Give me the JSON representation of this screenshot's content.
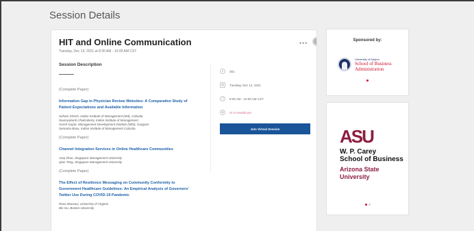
{
  "page": {
    "title": "Session Details"
  },
  "session": {
    "title": "HIT and Online Communication",
    "datetime": "Tuesday, Dec 14, 2021 at 8:30 AM - 10:00 AM CST",
    "more_icon": "more-horizontal-icon",
    "description_heading": "Session Description"
  },
  "papers": [
    {
      "type": "(Complete Paper)",
      "title_line1": "Information Gap in Physician Review Websites: A Comparative Study of",
      "title_line2": "Patient Expectations and Available Information",
      "authors": [
        "Soham Ghosh, Indian Institute of Management (IIM), Calcutta",
        "Soumyakanti Chakraborty, Indian Institute of Management",
        "Harsh Gupta, Management Development Institute (MDI), Gurgaon",
        "Samanta Basu, Indian Institute of Management Calcutta"
      ]
    },
    {
      "type": "(Complete Paper)",
      "title_line1": "Channel Integration Services in Online Healthcare Communities",
      "title_line2": "",
      "authors": [
        "Anqi Zhao, Singapore Management University",
        "Qian Tang, Singapore Management University"
      ]
    },
    {
      "type": "(Complete Paper)",
      "title_line1": "The Effect of Resilience Messaging on Community Conformity to",
      "title_line2": "Government Healthcare Guidelines: An Empirical Analysis of Governors'",
      "title_line3": "Twitter Use During COVID-19 Pandemic",
      "authors": [
        "Reza Mousavi, University of Virginia",
        "Bin Gu, Boston University"
      ]
    }
  ],
  "info": {
    "room": "301",
    "date": "Tuesday, Dec 14, 2021",
    "time": "8:30 AM - 10:00 AM CST",
    "track": "IS in Healthcare",
    "join_label": "Join Virtual Session"
  },
  "sponsor": {
    "heading": "Sponsored by:",
    "dayton_small": "University of Dayton",
    "dayton_line1": "School of Business",
    "dayton_line2": "Administration"
  },
  "asu": {
    "mark": "ASU",
    "line1": "W. P. Carey",
    "line2": "School of Business",
    "line3": "Arizona State",
    "line4": "University"
  },
  "colors": {
    "accent": "#1a5499",
    "link": "#1a5fa8",
    "track": "#d46a9b",
    "asu_maroon": "#8c1d40",
    "dayton_red": "#c8102e"
  }
}
